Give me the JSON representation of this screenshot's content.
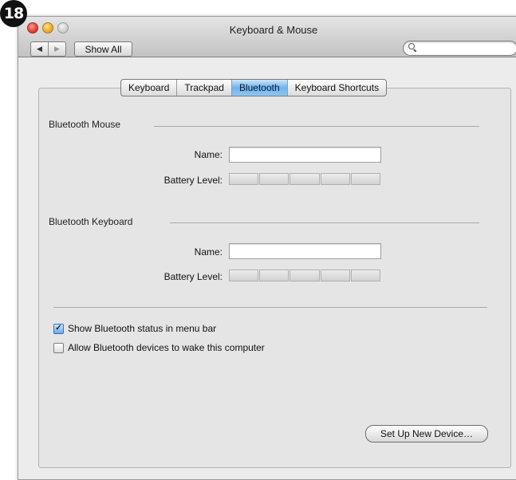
{
  "badge": "18",
  "window": {
    "title": "Keyboard & Mouse"
  },
  "toolbar": {
    "back_glyph": "◀",
    "forward_glyph": "▶",
    "show_all_label": "Show All",
    "search_placeholder": ""
  },
  "tabs": [
    {
      "label": "Keyboard",
      "active": false
    },
    {
      "label": "Trackpad",
      "active": false
    },
    {
      "label": "Bluetooth",
      "active": true
    },
    {
      "label": "Keyboard Shortcuts",
      "active": false
    }
  ],
  "mouse": {
    "section_label": "Bluetooth Mouse",
    "name_label": "Name:",
    "name_value": "",
    "battery_label": "Battery Level:",
    "battery_level": 0
  },
  "keyboard": {
    "section_label": "Bluetooth Keyboard",
    "name_label": "Name:",
    "name_value": "",
    "battery_label": "Battery Level:",
    "battery_level": 0
  },
  "options": [
    {
      "label": "Show Bluetooth status in menu bar",
      "checked": true
    },
    {
      "label": "Allow Bluetooth devices to wake this computer",
      "checked": false
    }
  ],
  "setup_button_label": "Set Up New Device…",
  "colors": {
    "accent": "#6fb3ee",
    "window_bg": "#ececec"
  },
  "icons": [
    "back-arrow-icon",
    "forward-arrow-icon",
    "search-icon",
    "checkmark-icon"
  ]
}
